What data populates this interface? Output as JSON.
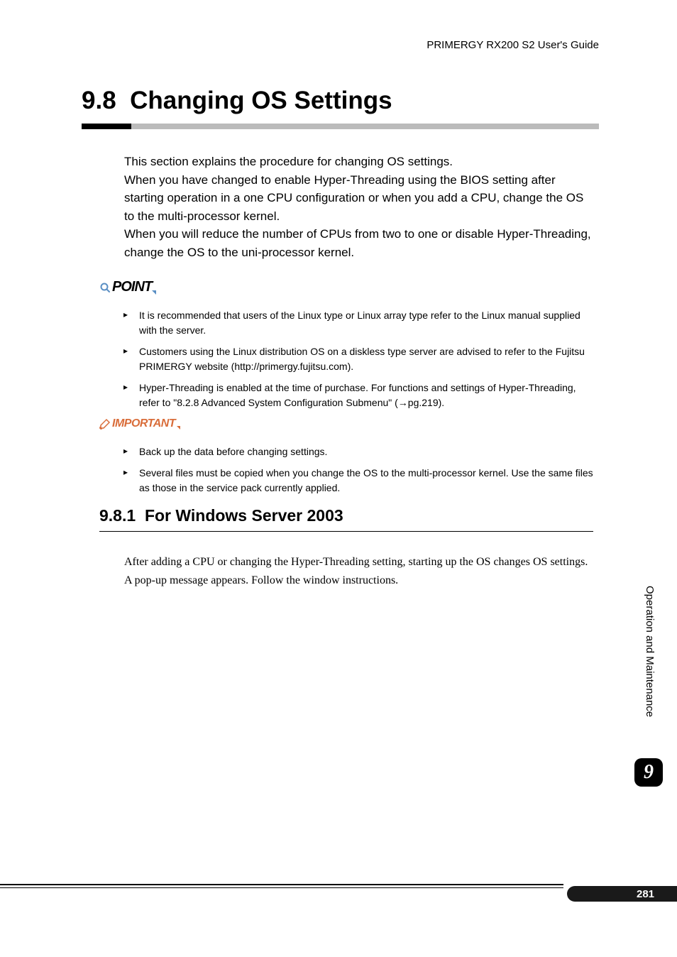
{
  "header": {
    "doc_title": "PRIMERGY RX200 S2 User's Guide"
  },
  "chapter": {
    "number": "9.8",
    "title": "Changing OS Settings"
  },
  "intro": {
    "p1": "This section explains the procedure for changing OS settings.",
    "p2": "When you have changed to enable Hyper-Threading using the BIOS setting after starting operation in a one CPU configuration or when you add a CPU, change the OS to the multi-processor kernel.",
    "p3": "When you will reduce the number of CPUs from two to one or disable Hyper-Threading, change the OS to the uni-processor kernel."
  },
  "point": {
    "label": "POINT",
    "items": [
      "It is recommended that users of the Linux type or Linux array type refer to the Linux manual supplied with the server.",
      "Customers using the Linux distribution OS on a diskless type server are advised to refer to the Fujitsu PRIMERGY website (http://primergy.fujitsu.com).",
      "Hyper-Threading is enabled at the time of purchase. For functions and settings of Hyper-Threading, refer to \"8.2.8 Advanced System Configuration Submenu\" (→pg.219)."
    ]
  },
  "important": {
    "label": "IMPORTANT",
    "items": [
      "Back up the data before changing settings.",
      "Several files must be copied when you change the OS to the multi-processor kernel. Use the same files as those in the service pack currently applied."
    ]
  },
  "subsection": {
    "number": "9.8.1",
    "title": "For Windows Server 2003",
    "para": "After adding a CPU or changing the Hyper-Threading setting, starting up the OS changes OS settings. A pop-up message appears. Follow the window instructions."
  },
  "side": {
    "text": "Operation and Maintenance",
    "chapter_num": "9"
  },
  "footer": {
    "page_num": "281"
  }
}
